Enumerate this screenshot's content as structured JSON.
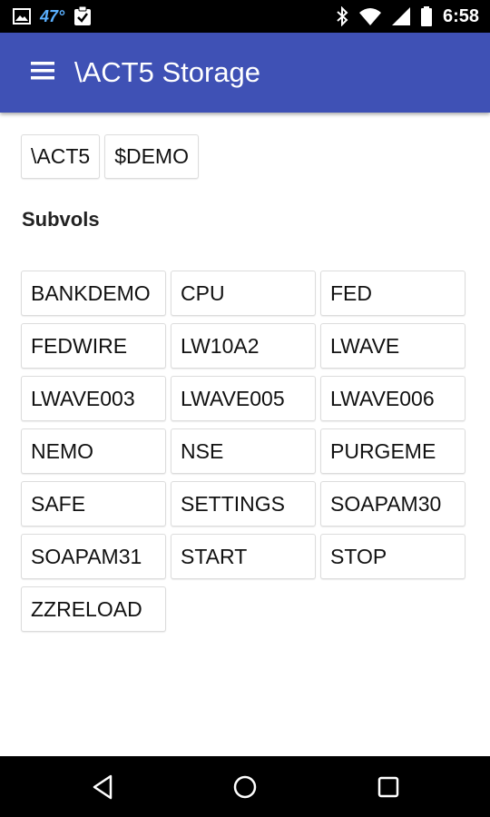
{
  "status_bar": {
    "temperature": "47°",
    "time": "6:58",
    "icons": [
      "image-icon",
      "clipboard-check-icon",
      "bluetooth-icon",
      "wifi-icon",
      "signal-icon",
      "battery-icon"
    ]
  },
  "app_bar": {
    "title": "\\ACT5 Storage",
    "menu_icon": "hamburger-menu-icon",
    "color": "#3f51b5"
  },
  "path": [
    "\\ACT5",
    "$DEMO"
  ],
  "subvols": {
    "title": "Subvols",
    "items": [
      "BANKDEMO",
      "CPU",
      "FED",
      "FEDWIRE",
      "LW10A2",
      "LWAVE",
      "LWAVE003",
      "LWAVE005",
      "LWAVE006",
      "NEMO",
      "NSE",
      "PURGEME",
      "SAFE",
      "SETTINGS",
      "SOAPAM30",
      "SOAPAM31",
      "START",
      "STOP",
      "ZZRELOAD"
    ]
  },
  "nav_bar": {
    "icons": [
      "back-icon",
      "home-icon",
      "recents-icon"
    ]
  }
}
